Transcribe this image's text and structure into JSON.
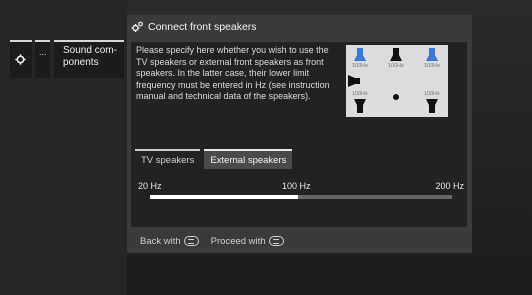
{
  "menu": {
    "dots_label": "...",
    "sound_label_line1": "Sound com-",
    "sound_label_line2": "ponents"
  },
  "dialog": {
    "title": "Connect front speakers",
    "description": "Please specify here whether you wish to use the TV speakers or external front speakers as front speakers. In the latter case, their lower limit frequency must be entered in Hz (see instruction manual and technical data of the speakers).",
    "speaker_labels": [
      "100Hz",
      "100Hz",
      "100Hz",
      "100Hz",
      "100Hz"
    ],
    "tabs": [
      {
        "label": "TV speakers",
        "active": false
      },
      {
        "label": "External speakers",
        "active": true
      }
    ],
    "frequency": {
      "min_label": "20 Hz",
      "mid_label": "100 Hz",
      "max_label": "200 Hz",
      "value_fraction": 0.49
    },
    "footer": {
      "back_label": "Back with",
      "proceed_label": "Proceed with"
    }
  },
  "colors": {
    "accent_speaker": "#3a7bd5",
    "dialog_bg": "#3b3b3b",
    "panel_bg": "#222222"
  }
}
